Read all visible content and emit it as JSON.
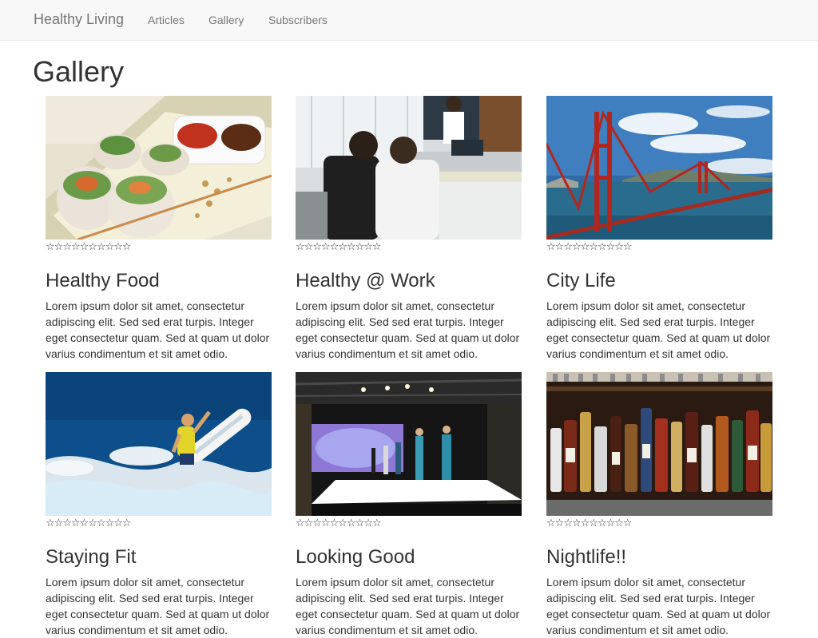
{
  "navbar": {
    "brand": "Healthy Living",
    "links": [
      "Articles",
      "Gallery",
      "Subscribers"
    ]
  },
  "page": {
    "title": "Gallery"
  },
  "gallery": {
    "star_glyph": "☆",
    "star_count": 10,
    "items": [
      {
        "title": "Healthy Food",
        "text": "Lorem ipsum dolor sit amet, consectetur adipiscing elit. Sed sed erat turpis. Integer eget consectetur quam. Sed at quam ut dolor varius condimentum et sit amet odio.",
        "image": "sushi-rolls-photo",
        "rating": 0
      },
      {
        "title": "Healthy @ Work",
        "text": "Lorem ipsum dolor sit amet, consectetur adipiscing elit. Sed sed erat turpis. Integer eget consectetur quam. Sed at quam ut dolor varius condimentum et sit amet odio.",
        "image": "office-reception-photo",
        "rating": 0
      },
      {
        "title": "City Life",
        "text": "Lorem ipsum dolor sit amet, consectetur adipiscing elit. Sed sed erat turpis. Integer eget consectetur quam. Sed at quam ut dolor varius condimentum et sit amet odio.",
        "image": "golden-gate-bridge-photo",
        "rating": 0
      },
      {
        "title": "Staying Fit",
        "text": "Lorem ipsum dolor sit amet, consectetur adipiscing elit. Sed sed erat turpis. Integer eget consectetur quam. Sed at quam ut dolor varius condimentum et sit amet odio.",
        "image": "surfer-photo",
        "rating": 0
      },
      {
        "title": "Looking Good",
        "text": "Lorem ipsum dolor sit amet, consectetur adipiscing elit. Sed sed erat turpis. Integer eget consectetur quam. Sed at quam ut dolor varius condimentum et sit amet odio.",
        "image": "fashion-runway-photo",
        "rating": 0
      },
      {
        "title": "Nightlife!!",
        "text": "Lorem ipsum dolor sit amet, consectetur adipiscing elit. Sed sed erat turpis. Integer eget consectetur quam. Sed at quam ut dolor varius condimentum et sit amet odio.",
        "image": "bar-bottles-photo",
        "rating": 0
      }
    ]
  },
  "colors": {
    "navbar_bg": "#f8f8f8",
    "nav_text": "#777777",
    "body_text": "#333333"
  }
}
